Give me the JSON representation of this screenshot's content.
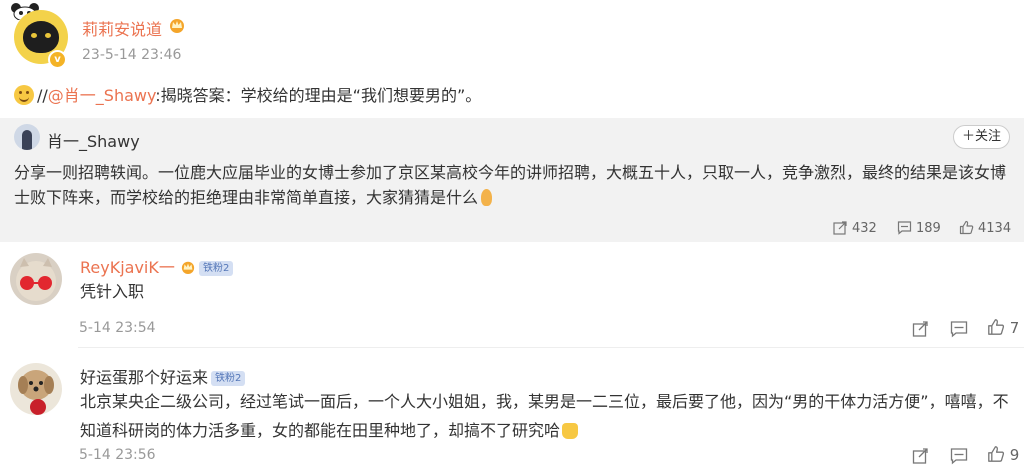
{
  "post": {
    "author": "莉莉安说道",
    "time": "23-5-14 23:46",
    "text_sep": "//",
    "mention": "@肖一_Shawy",
    "text_rest": ":揭晓答案：学校给的理由是“我们想要男的”。"
  },
  "repost": {
    "author": "肖一_Shawy",
    "follow_label": "＋关注",
    "text": "分享一则招聘轶闻。一位鹿大应届毕业的女博士参加了京区某高校今年的讲师招聘，大概五十人，只取一人，竞争激烈，最终的结果是该女博士败下阵来，而学校给的拒绝理由非常简单直接，大家猜猜是什么",
    "reposts": "432",
    "comments": "189",
    "likes": "4134"
  },
  "comments": [
    {
      "author": "ReyKjaviK一",
      "badge": "铁粉2",
      "text": "凭针入职",
      "time": "5-14 23:54",
      "likes": "7"
    },
    {
      "author": "好运蛋那个好运来",
      "badge": "铁粉2",
      "text": "北京某央企二级公司，经过笔试一面后，一个人大小姐姐，我，某男是一二三位，最后要了他，因为“男的干体力活方便”，嘻嘻，不知道科研岗的体力活多重，女的都能在田里种地了，却搞不了研究哈",
      "time": "5-14 23:56",
      "likes": "9"
    }
  ],
  "colors": {
    "accent": "#eb7350",
    "muted": "#999999",
    "repost_bg": "#f2f2f2"
  },
  "icons": [
    "panda-icon",
    "crown-icon",
    "verified-badge-icon",
    "smile-emoji-icon",
    "ear-emoji-icon",
    "repost-icon",
    "comment-icon",
    "like-icon",
    "thumbs-up-emoji-icon"
  ]
}
